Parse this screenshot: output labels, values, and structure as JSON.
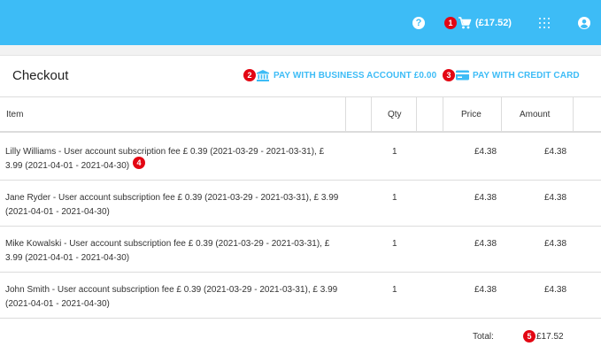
{
  "topbar": {
    "help_glyph": "?",
    "cart_total": "(£17.52)",
    "icons": [
      "help-icon",
      "cart-icon",
      "apps-grid-icon",
      "account-icon"
    ],
    "bg_color": "#3dbcf6"
  },
  "badges": [
    "1",
    "2",
    "3",
    "4",
    "5"
  ],
  "checkout": {
    "title": "Checkout",
    "pay_business_label": "PAY WITH BUSINESS ACCOUNT £0.00",
    "pay_card_label": "PAY WITH CREDIT CARD"
  },
  "table": {
    "headers": {
      "item": "Item",
      "qty": "Qty",
      "price": "Price",
      "amount": "Amount"
    },
    "rows": [
      {
        "description": "Lilly Williams - User account subscription fee £ 0.39 (2021-03-29 - 2021-03-31), £ 3.99 (2021-04-01 - 2021-04-30)",
        "qty": "1",
        "price": "£4.38",
        "amount": "£4.38"
      },
      {
        "description": "Jane Ryder - User account subscription fee £ 0.39 (2021-03-29 - 2021-03-31), £ 3.99 (2021-04-01 - 2021-04-30)",
        "qty": "1",
        "price": "£4.38",
        "amount": "£4.38"
      },
      {
        "description": "Mike Kowalski - User account subscription fee £ 0.39 (2021-03-29 - 2021-03-31), £ 3.99 (2021-04-01 - 2021-04-30)",
        "qty": "1",
        "price": "£4.38",
        "amount": "£4.38"
      },
      {
        "description": "John Smith - User account subscription fee £ 0.39 (2021-03-29 - 2021-03-31), £ 3.99 (2021-04-01 - 2021-04-30)",
        "qty": "1",
        "price": "£4.38",
        "amount": "£4.38"
      }
    ],
    "total_label": "Total:",
    "total_value": "£17.52"
  }
}
